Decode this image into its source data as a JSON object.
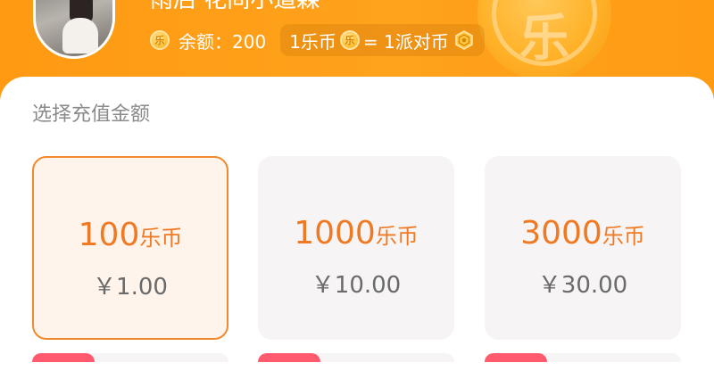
{
  "header": {
    "user_name": "雨后 花间小道森",
    "balance_label": "余额：200",
    "rate": {
      "left": "1乐币",
      "right": "= 1派对币"
    },
    "coin_glyph": "乐",
    "bg_coin_glyph": "乐"
  },
  "recharge": {
    "section_title": "选择充值金额",
    "options": [
      {
        "amount": "100",
        "unit": "乐币",
        "price": "￥1.00",
        "selected": true
      },
      {
        "amount": "1000",
        "unit": "乐币",
        "price": "￥10.00",
        "selected": false
      },
      {
        "amount": "3000",
        "unit": "乐币",
        "price": "￥30.00",
        "selected": false
      }
    ]
  },
  "colors": {
    "header_orange": "#ffa21c",
    "accent_orange": "#f07a24",
    "selected_border": "#f08a2c",
    "badge_red": "#ff5a6e"
  }
}
